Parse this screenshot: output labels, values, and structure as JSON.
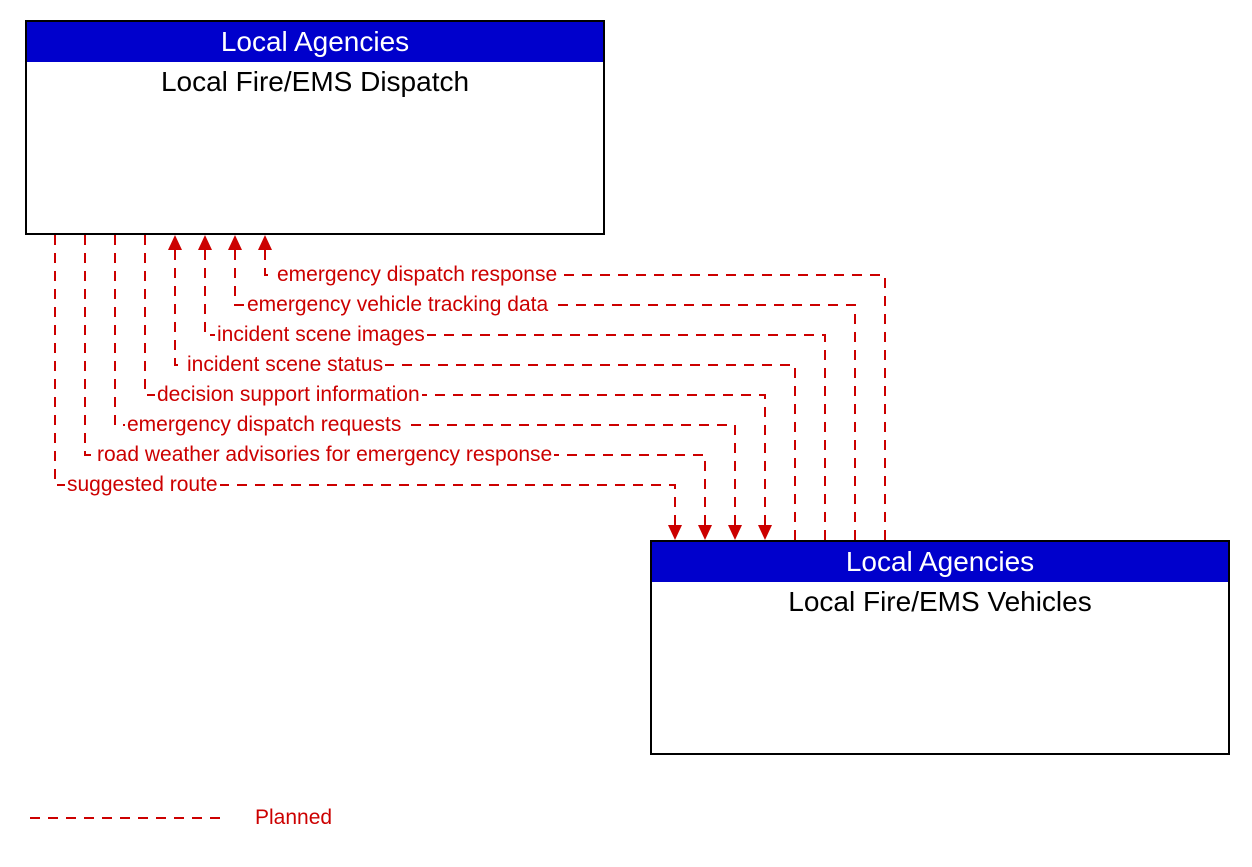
{
  "boxTop": {
    "header": "Local Agencies",
    "title": "Local Fire/EMS Dispatch"
  },
  "boxBottom": {
    "header": "Local Agencies",
    "title": "Local Fire/EMS Vehicles"
  },
  "flows": {
    "toTop": [
      "emergency dispatch response",
      "emergency vehicle tracking data",
      "incident scene images",
      "incident scene status"
    ],
    "toBottom": [
      "decision support information",
      "emergency dispatch requests",
      "road weather advisories for emergency response",
      "suggested route"
    ]
  },
  "legend": {
    "planned": "Planned"
  },
  "colors": {
    "headerBg": "#0000cc",
    "flow": "#cc0000"
  }
}
